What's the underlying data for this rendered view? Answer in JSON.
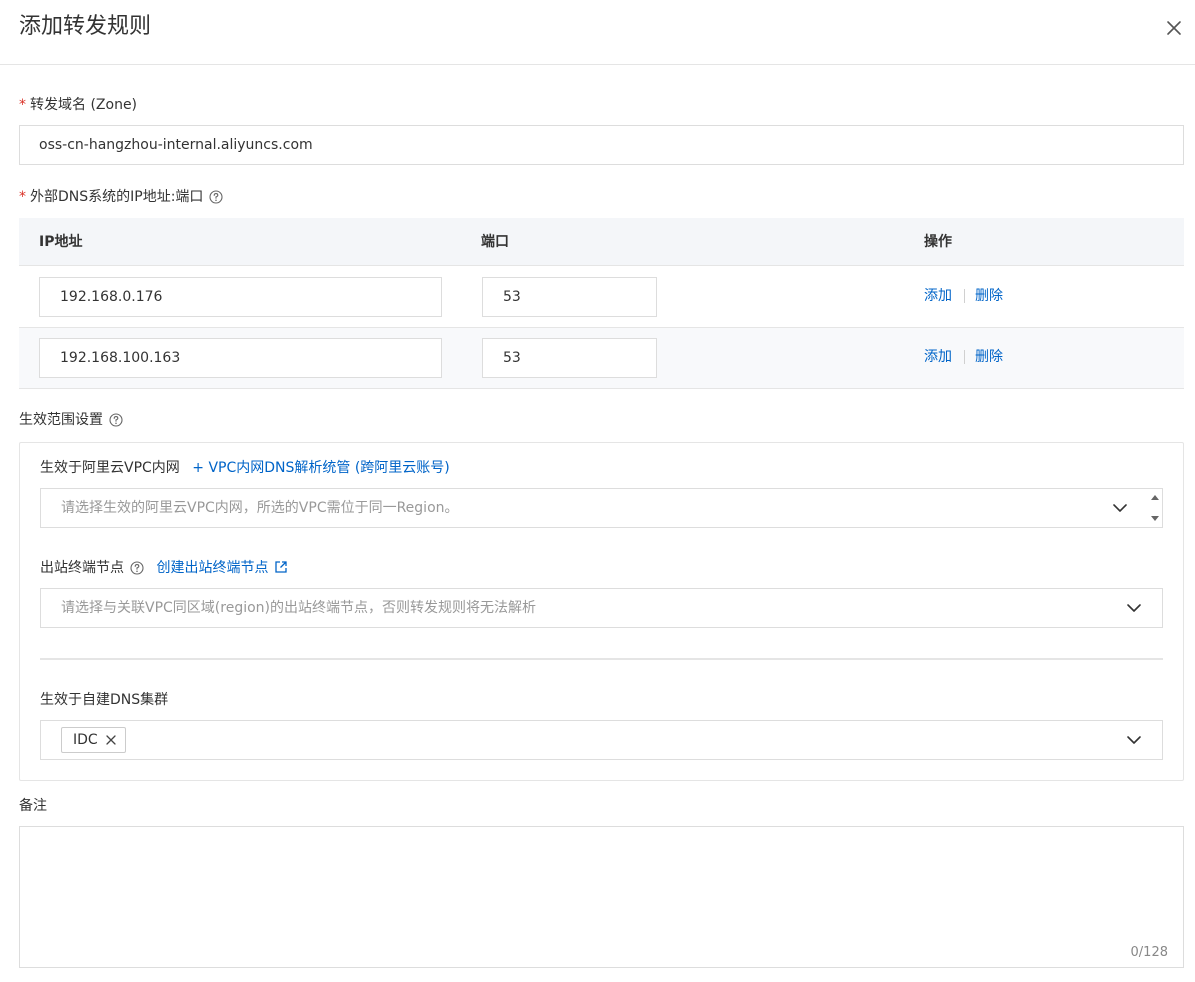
{
  "dialog": {
    "title": "添加转发规则"
  },
  "zone": {
    "required_mark": "*",
    "label": "转发域名 (Zone)",
    "value": "oss-cn-hangzhou-internal.aliyuncs.com"
  },
  "dns": {
    "required_mark": "*",
    "label": "外部DNS系统的IP地址:端口",
    "columns": {
      "ip": "IP地址",
      "port": "端口",
      "action": "操作"
    },
    "rows": [
      {
        "ip": "192.168.0.176",
        "port": "53",
        "add": "添加",
        "delete": "删除"
      },
      {
        "ip": "192.168.100.163",
        "port": "53",
        "add": "添加",
        "delete": "删除"
      }
    ]
  },
  "scope": {
    "label": "生效范围设置",
    "vpc": {
      "label": "生效于阿里云VPC内网",
      "link_plus": "+",
      "link": "VPC内网DNS解析统管 (跨阿里云账号)",
      "placeholder": "请选择生效的阿里云VPC内网，所选的VPC需位于同一Region。"
    },
    "outbound": {
      "label": "出站终端节点",
      "link": "创建出站终端节点",
      "placeholder": "请选择与关联VPC同区域(region)的出站终端节点，否则转发规则将无法解析"
    },
    "cluster": {
      "label": "生效于自建DNS集群",
      "tags": [
        "IDC"
      ]
    }
  },
  "remark": {
    "label": "备注",
    "counter": "0/128"
  },
  "icons": {
    "close": "close-icon",
    "help": "help-circle-icon",
    "chevron": "chevron-down-icon",
    "spinner": "up-down-arrows-icon",
    "external": "external-link-icon",
    "tag_remove": "close-icon"
  },
  "colors": {
    "link": "#0064c8",
    "required": "#d93026",
    "table_header": "#f4f6f9",
    "border": "#dddddd"
  }
}
